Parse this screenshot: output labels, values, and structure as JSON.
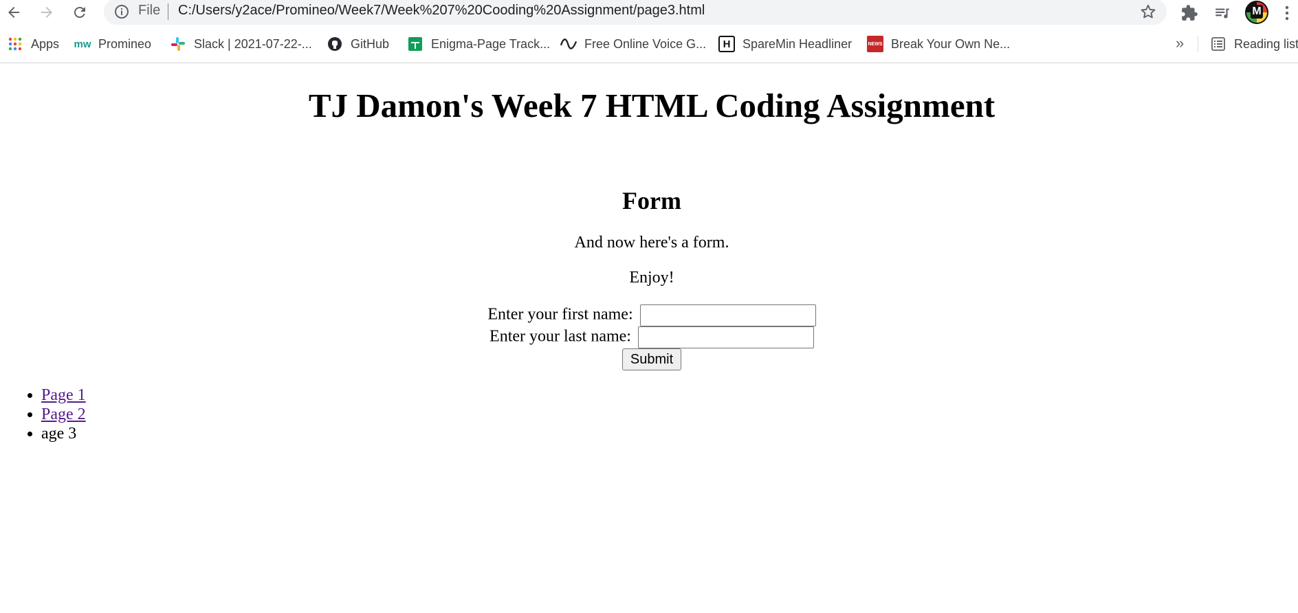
{
  "browser": {
    "address": {
      "scheme_label": "File",
      "url": "C:/Users/y2ace/Promineo/Week7/Week%207%20Cooding%20Assignment/page3.html"
    },
    "bookmarks": [
      {
        "label": "Apps",
        "icon": "apps-grid-icon"
      },
      {
        "label": "Promineo",
        "icon": "promineo-logo-icon"
      },
      {
        "label": "Slack | 2021-07-22-...",
        "icon": "slack-icon"
      },
      {
        "label": "GitHub",
        "icon": "github-icon"
      },
      {
        "label": "Enigma-Page Track...",
        "icon": "sheets-icon"
      },
      {
        "label": "Free Online Voice G...",
        "icon": "wave-icon"
      },
      {
        "label": "SpareMin Headliner",
        "icon": "headliner-icon"
      },
      {
        "label": "Break Your Own Ne...",
        "icon": "break-news-icon"
      }
    ],
    "more_label": "»",
    "reading_list_label": "Reading list",
    "promineo_icon_text": "mw",
    "headliner_icon_text": "H",
    "break_news_icon_text": "NEWS"
  },
  "page": {
    "title": "TJ Damon's Week 7 HTML Coding Assignment",
    "form_heading": "Form",
    "intro": "And now here's a form.",
    "enjoy": "Enjoy!",
    "first_name_label": "Enter your first name:",
    "first_name_value": "",
    "last_name_label": "Enter your last name:",
    "last_name_value": "",
    "submit_label": "Submit",
    "nav": {
      "page1": "Page 1",
      "page2": "Page 2",
      "page3": "age 3"
    }
  },
  "colors": {
    "link_visited": "#551a8b",
    "omnibox_bg": "#f1f3f4"
  }
}
